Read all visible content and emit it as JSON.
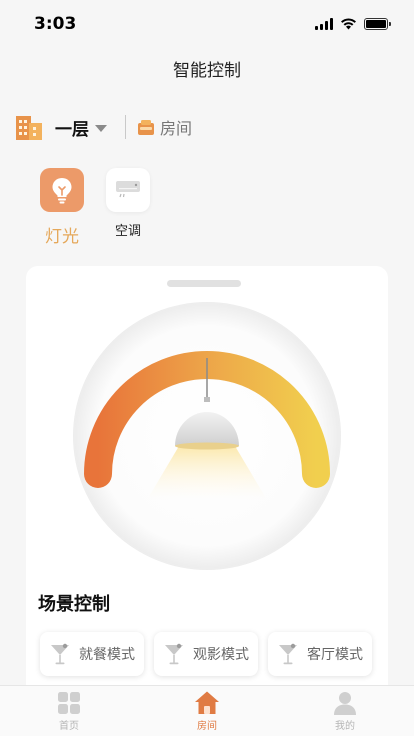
{
  "status_bar": {
    "time": "3:03"
  },
  "header": {
    "title": "智能控制"
  },
  "location": {
    "floor": "一层",
    "room": "房间"
  },
  "device_tabs": [
    {
      "label": "灯光",
      "icon": "light-bulb-icon",
      "active": true
    },
    {
      "label": "空调",
      "icon": "air-conditioner-icon",
      "active": false
    }
  ],
  "scene": {
    "title": "场景控制",
    "buttons": [
      {
        "label": "就餐模式",
        "icon": "cocktail-glass-icon"
      },
      {
        "label": "观影模式",
        "icon": "cocktail-glass-icon"
      },
      {
        "label": "客厅模式",
        "icon": "cocktail-glass-icon"
      }
    ]
  },
  "tab_bar": {
    "items": [
      {
        "label": "首页",
        "icon": "grid-icon",
        "active": false
      },
      {
        "label": "房间",
        "icon": "house-icon",
        "active": true
      },
      {
        "label": "我的",
        "icon": "person-icon",
        "active": false
      }
    ]
  },
  "colors": {
    "accent": "#e07b43",
    "active_tile": "#ec9a69",
    "active_label": "#e5a85a",
    "dial_gradient_start": "#e8743a",
    "dial_gradient_end": "#f1cf4e"
  }
}
